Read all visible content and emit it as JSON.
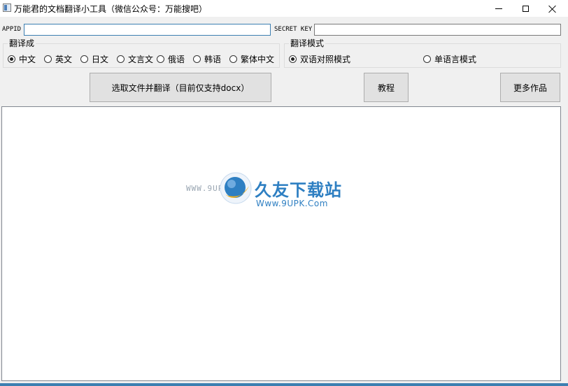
{
  "window": {
    "title": "万能君的文档翻译小工具（微信公众号：万能搜吧）",
    "controls": [
      "minimize",
      "maximize",
      "close"
    ]
  },
  "credentials": {
    "appid_label": "APPID",
    "appid_value": "",
    "secret_label": "SECRET KEY",
    "secret_value": ""
  },
  "translate_to": {
    "title": "翻译成",
    "options": [
      "中文",
      "英文",
      "日文",
      "文言文",
      "俄语",
      "韩语",
      "繁体中文"
    ],
    "selected": "中文"
  },
  "translate_mode": {
    "title": "翻译模式",
    "options": [
      "双语对照模式",
      "单语言模式"
    ],
    "selected": "双语对照模式"
  },
  "buttons": {
    "select_file": "选取文件并翻译（目前仅支持docx）",
    "tutorial": "教程",
    "more_works": "更多作品"
  },
  "watermark": {
    "left_text": "WWW.9UPK.",
    "name": "久友下载站",
    "url": "Www.9UPK.Com"
  },
  "colors": {
    "accent": "#3c7fb1",
    "watermark_blue": "#2e7fc2",
    "logo_gold": "#f2b01e"
  }
}
